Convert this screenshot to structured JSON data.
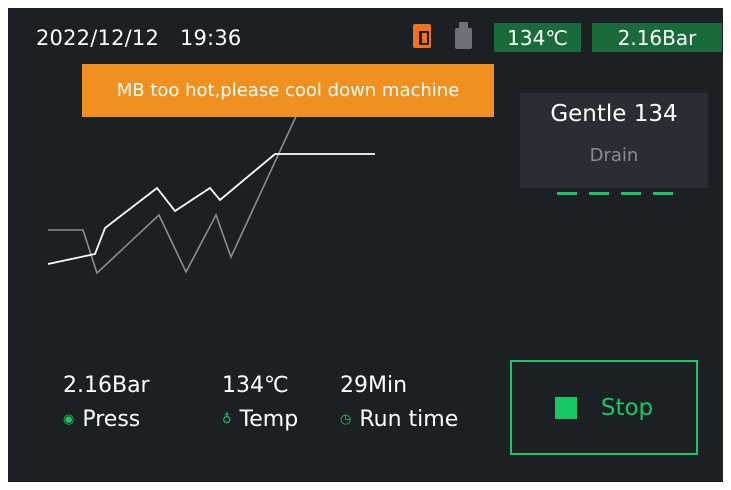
{
  "status_bar": {
    "date": "2022/12/12",
    "time": "19:36",
    "door_icon": "door-open-icon",
    "usb_icon": "usb-icon",
    "temperature_badge": "134℃",
    "pressure_badge": "2.16Bar"
  },
  "alert": {
    "message": "MB too hot,please cool down machine",
    "color": "#f2901f"
  },
  "program": {
    "name": "Gentle 134",
    "phase": "Drain",
    "phase_step_count": 4
  },
  "readings": {
    "pressure": {
      "value": "2.16Bar",
      "label": "Press",
      "icon": "gauge-icon"
    },
    "temperature": {
      "value": "134℃",
      "label": "Temp",
      "icon": "thermometer-icon"
    },
    "run_time": {
      "value": "29Min",
      "label": "Run time",
      "icon": "clock-icon"
    }
  },
  "stop_button": {
    "label": "Stop",
    "icon": "stop-square-icon"
  },
  "colors": {
    "background": "#1c1f24",
    "accent_green": "#17c964",
    "badge_green": "#1a6b3c",
    "alert_orange": "#f2901f"
  }
}
